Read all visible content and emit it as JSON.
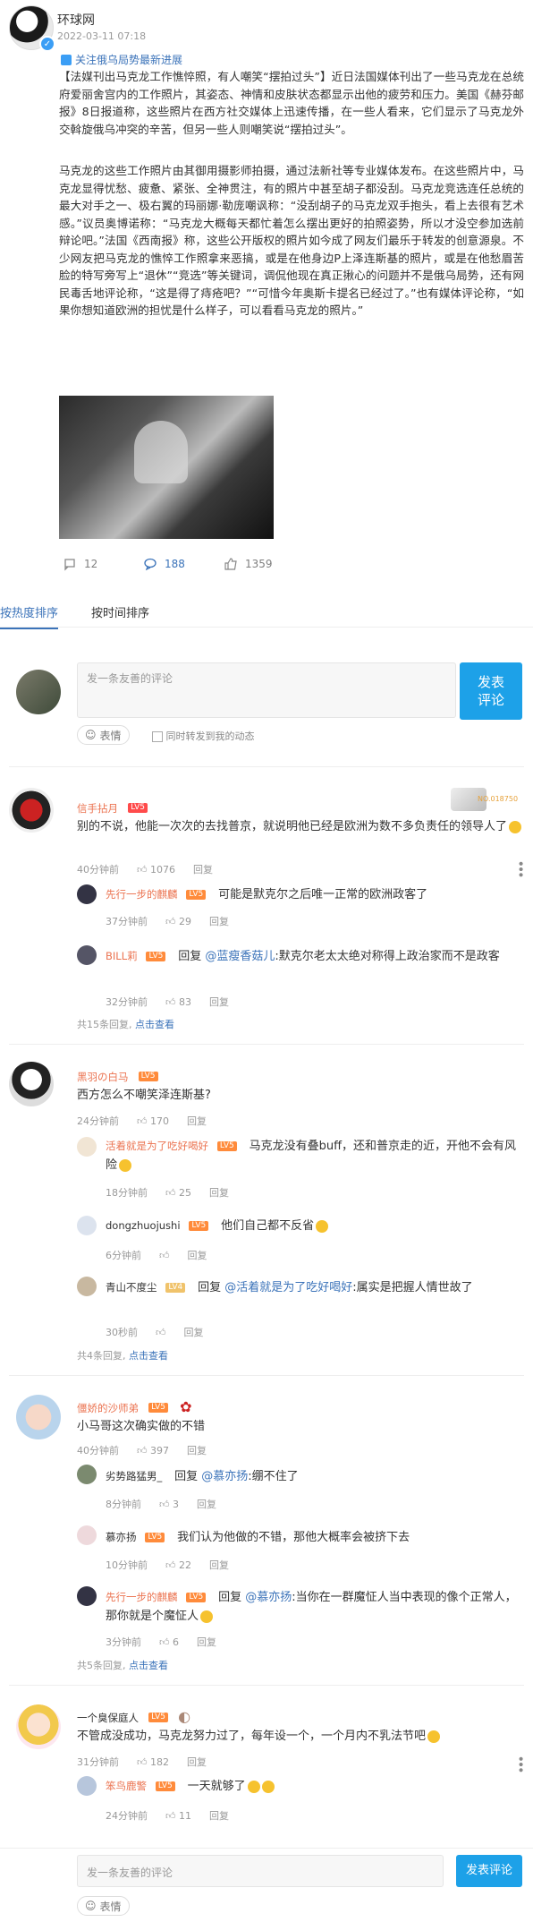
{
  "post": {
    "author": "环球网",
    "time": "2022-03-11 07:18",
    "topic": "关注俄乌局势最新进展",
    "paragraph1": "【法媒刊出马克龙工作憔悴照，有人嘲笑“摆拍过头”】近日法国媒体刊出了一些马克龙在总统府爱丽舍宫内的工作照片，其姿态、神情和皮肤状态都显示出他的疲劳和压力。美国《赫芬邮报》8日报道称，这些照片在西方社交媒体上迅速传播，在一些人看来，它们显示了马克龙外交斡旋俄乌冲突的辛苦，但另一些人则嘲笑说“摆拍过头”。",
    "paragraph2": "马克龙的这些工作照片由其御用摄影师拍摄，通过法新社等专业媒体发布。在这些照片中，马克龙显得忧愁、疲惫、紧张、全神贯注，有的照片中甚至胡子都没刮。马克龙竞选连任总统的最大对手之一、极右翼的玛丽娜·勒庞嘲讽称：“没刮胡子的马克龙双手抱头，看上去很有艺术感。”议员奥博诺称：“马克龙大概每天都忙着怎么摆出更好的拍照姿势，所以才没空参加选前辩论吧。”法国《西南报》称，这些公开版权的照片如今成了网友们最乐于转发的创意源泉。不少网友把马克龙的憔悴工作照拿来恶搞，或是在他身边P上泽连斯基的照片，或是在他愁眉苦脸的特写旁写上“退休”“竞选”等关键词，调侃他现在真正揪心的问题并不是俄乌局势，还有网民毒舌地评论称，“这是得了痔疮吧？”“可惜今年奥斯卡提名已经过了。”也有媒体评论称，“如果你想知道欧洲的担忧是什么样子，可以看看马克龙的照片。”",
    "reposts": "12",
    "comments": "188",
    "likes": "1359"
  },
  "tabs": {
    "hot": "按热度排序",
    "time": "按时间排序"
  },
  "composer": {
    "placeholder": "发一条友善的评论",
    "submit": "发表评论",
    "emoji": "表情",
    "repost_option": "同时转发到我的动态"
  },
  "comments": [
    {
      "name": "信手拈月",
      "level": "LV5",
      "badge_text": "NO.018750",
      "text": "别的不说，他能一次次的去找普京，就说明他已经是欧洲为数不多负责任的领导人了",
      "time": "40分钟前",
      "likes": "1076",
      "reply_label": "回复",
      "replies": [
        {
          "name": "先行一步的麒麟",
          "level": "LV5",
          "text": "可能是默克尔之后唯一正常的欧洲政客了",
          "time": "37分钟前",
          "likes": "29",
          "reply_label": "回复"
        },
        {
          "name": "BILL莉",
          "level": "LV5",
          "prefix": "回复",
          "reply_to": "@蓝瘦香菇儿",
          "text": ":默克尔老太太绝对称得上政治家而不是政客",
          "time": "32分钟前",
          "likes": "83",
          "reply_label": "回复"
        }
      ],
      "more_count": "共15条回复,",
      "more_link": "点击查看"
    },
    {
      "name": "黑羽の白马",
      "level": "LV5",
      "text": "西方怎么不嘲笑泽连斯基?",
      "time": "24分钟前",
      "likes": "170",
      "reply_label": "回复",
      "replies": [
        {
          "name": "活着就是为了吃好喝好",
          "level": "LV5",
          "text": "马克龙没有叠buff，还和普京走的近，开他不会有风险",
          "time": "18分钟前",
          "likes": "25",
          "reply_label": "回复"
        },
        {
          "name": "dongzhuojushi",
          "level": "LV5",
          "text": "他们自己都不反省",
          "time": "6分钟前",
          "likes": "",
          "reply_label": "回复"
        },
        {
          "name": "青山不度尘",
          "level": "LV4",
          "prefix": "回复",
          "reply_to": "@活着就是为了吃好喝好",
          "text": ":属实是把握人情世故了",
          "time": "30秒前",
          "likes": "",
          "reply_label": "回复"
        }
      ],
      "more_count": "共4条回复,",
      "more_link": "点击查看"
    },
    {
      "name": "僵娇的沙师弟",
      "level": "LV5",
      "text": "小马哥这次确实做的不错",
      "time": "40分钟前",
      "likes": "397",
      "reply_label": "回复",
      "replies": [
        {
          "name": "劣势路猛男_",
          "level": "",
          "prefix": "回复",
          "reply_to": "@慕亦扬",
          "text": ":绷不住了",
          "time": "8分钟前",
          "likes": "3",
          "reply_label": "回复"
        },
        {
          "name": "慕亦扬",
          "level": "LV5",
          "text": "我们认为他做的不错，那他大概率会被挤下去",
          "time": "10分钟前",
          "likes": "22",
          "reply_label": "回复"
        },
        {
          "name": "先行一步的麒麟",
          "level": "LV5",
          "prefix": "回复",
          "reply_to": "@慕亦扬",
          "text": ":当你在一群魔怔人当中表现的像个正常人，那你就是个魔怔人",
          "time": "3分钟前",
          "likes": "6",
          "reply_label": "回复"
        }
      ],
      "more_count": "共5条回复,",
      "more_link": "点击查看"
    },
    {
      "name": "一个臭保庭人",
      "level": "LV5",
      "text": "不管成没成功，马克龙努力过了，每年设一个，一个月内不乳法节吧",
      "time": "31分钟前",
      "likes": "182",
      "reply_label": "回复",
      "replies": [
        {
          "name": "笨鸟鹿警",
          "level": "LV5",
          "text": "一天就够了",
          "time": "24分钟前",
          "likes": "11",
          "reply_label": "回复"
        }
      ]
    }
  ],
  "colors": {
    "accent_blue": "#3b73b9",
    "submit_blue": "#1da1e8",
    "username_orange": "#eb7350",
    "level_red": "#ff4b4b"
  }
}
